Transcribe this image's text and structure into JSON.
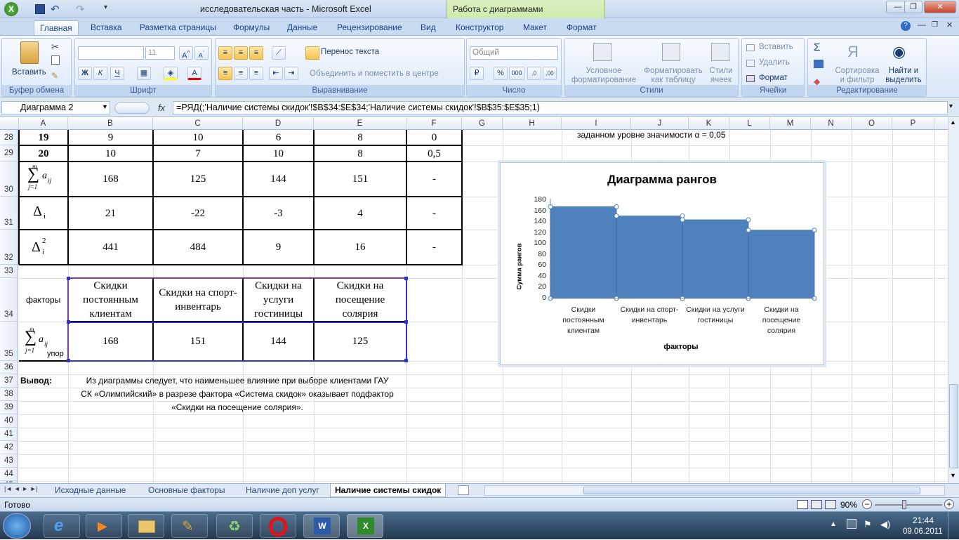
{
  "window": {
    "title": "исследовательская часть - Microsoft Excel",
    "context_tab": "Работа с диаграммами"
  },
  "tabs": [
    "Главная",
    "Вставка",
    "Разметка страницы",
    "Формулы",
    "Данные",
    "Рецензирование",
    "Вид",
    "Конструктор",
    "Макет",
    "Формат"
  ],
  "ribbon": {
    "clipboard": {
      "paste": "Вставить",
      "label": "Буфер обмена"
    },
    "font": {
      "name": "",
      "size": "11",
      "label": "Шрифт",
      "bold": "Ж",
      "italic": "К",
      "underline": "Ч"
    },
    "alignment": {
      "wrap": "Перенос текста",
      "merge": "Объединить и поместить в центре",
      "label": "Выравнивание"
    },
    "number": {
      "format": "Общий",
      "label": "Число",
      "percent": "%",
      "thousands": "000",
      "inc": ",0→,00",
      "dec": ",00→,0"
    },
    "styles": {
      "conditional": "Условное форматирование",
      "table": "Форматировать как таблицу",
      "cell": "Стили ячеек",
      "label": "Стили"
    },
    "cells": {
      "insert": "Вставить",
      "delete": "Удалить",
      "format": "Формат",
      "label": "Ячейки"
    },
    "editing": {
      "sum": "Σ",
      "sort": "Сортировка и фильтр",
      "find": "Найти и выделить",
      "label": "Редактирование"
    }
  },
  "formula_bar": {
    "name_box": "Диаграмма 2",
    "fx": "fx",
    "formula": "=РЯД(;'Наличие системы скидок'!$B$34:$E$34;'Наличие системы скидок'!$B$35:$E$35;1)"
  },
  "columns": [
    "A",
    "B",
    "C",
    "D",
    "E",
    "F",
    "G",
    "H",
    "I",
    "J",
    "K",
    "L",
    "M",
    "N",
    "O",
    "P"
  ],
  "rows": [
    "28",
    "29",
    "30",
    "31",
    "32",
    "33",
    "34",
    "35",
    "36",
    "37",
    "38",
    "39",
    "40",
    "41",
    "42",
    "43",
    "44",
    "45"
  ],
  "table1": {
    "r28": [
      "19",
      "9",
      "10",
      "6",
      "8",
      "0"
    ],
    "r29": [
      "20",
      "10",
      "7",
      "10",
      "8",
      "0,5"
    ],
    "r30": [
      "",
      "168",
      "125",
      "144",
      "151",
      "-"
    ],
    "r31": [
      "",
      "21",
      "-22",
      "-3",
      "4",
      "-"
    ],
    "r32": [
      "",
      "441",
      "484",
      "9",
      "16",
      "-"
    ]
  },
  "sum_symbol": "∑",
  "sum_top": "m",
  "sum_bottom": "j=1",
  "sum_term": "a",
  "sum_sub": "ij",
  "delta": "Δ",
  "delta_sub": "i",
  "delta_sup": "2",
  "table2": {
    "factors_label": "факторы",
    "headers": [
      "Скидки постоянным клиентам",
      "Скидки на спорт-инвентарь",
      "Скидки на услуги гостиницы",
      "Скидки на посещение солярия"
    ],
    "values": [
      "168",
      "151",
      "144",
      "125"
    ],
    "sum_suffix": "упор"
  },
  "note_h28": "заданном  уровне значимости  α = 0,05",
  "conclusion": {
    "label": "Вывод:",
    "lines": [
      "Из диаграммы следует, что  наименьшее влияние при выборе клиентами  ГАУ",
      "СК «Олимпийский» в разрезе фактора «Система скидок» оказывает подфактор",
      "«Скидки на посещение солярия»."
    ]
  },
  "chart_data": {
    "type": "area",
    "title": "Диаграмма рангов",
    "xlabel": "факторы",
    "ylabel": "Сумма рангов",
    "ylim": [
      0,
      180
    ],
    "yticks": [
      0,
      20,
      40,
      60,
      80,
      100,
      120,
      140,
      160,
      180
    ],
    "categories": [
      "Скидки постоянным клиентам",
      "Скидки на спорт-инвентарь",
      "Скидки на услуги гостиницы",
      "Скидки на посещение солярия"
    ],
    "category_lines": [
      [
        "Скидки",
        "постоянным",
        "клиентам"
      ],
      [
        "Скидки на спорт-",
        "инвентарь"
      ],
      [
        "Скидки на услуги",
        "гостиницы"
      ],
      [
        "Скидки на",
        "посещение",
        "солярия"
      ]
    ],
    "values": [
      168,
      151,
      144,
      125
    ],
    "color": "#4f81bd"
  },
  "sheet_tabs": [
    "Исходные данные",
    "Основные факторы",
    "Наличие доп услуг",
    "Наличие системы скидок"
  ],
  "status": {
    "ready": "Готово",
    "zoom": "90%"
  },
  "taskbar": {
    "time": "21:44",
    "date": "09.06.2011"
  }
}
